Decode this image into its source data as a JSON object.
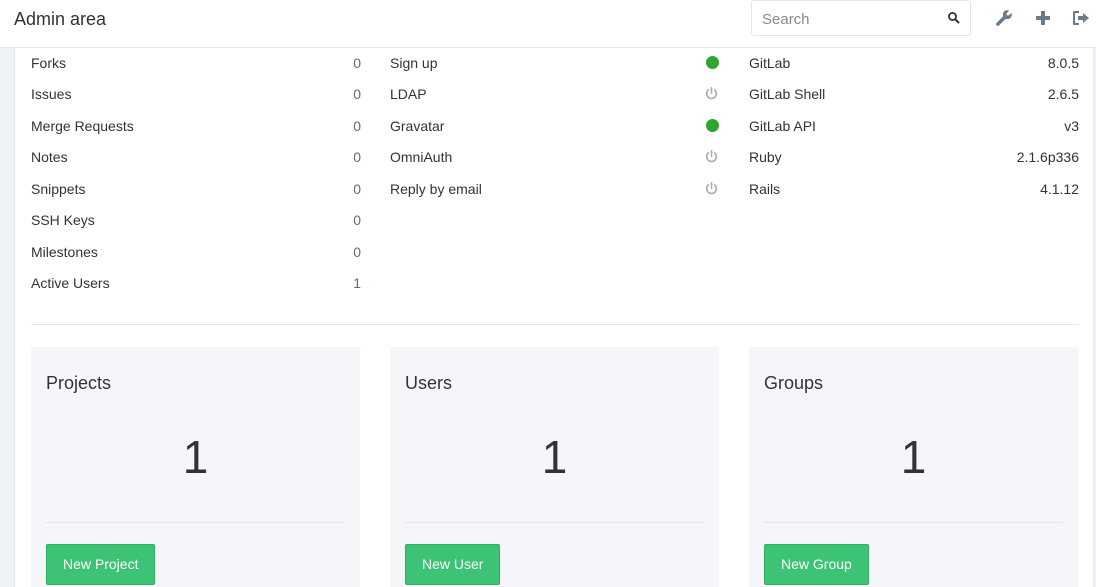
{
  "header": {
    "title": "Admin area",
    "search_placeholder": "Search",
    "icons": [
      "wrench-icon",
      "plus-icon",
      "sign-out-icon"
    ]
  },
  "stats": [
    {
      "label": "Forks",
      "value": "0"
    },
    {
      "label": "Issues",
      "value": "0"
    },
    {
      "label": "Merge Requests",
      "value": "0"
    },
    {
      "label": "Notes",
      "value": "0"
    },
    {
      "label": "Snippets",
      "value": "0"
    },
    {
      "label": "SSH Keys",
      "value": "0"
    },
    {
      "label": "Milestones",
      "value": "0"
    },
    {
      "label": "Active Users",
      "value": "1"
    }
  ],
  "features": [
    {
      "label": "Sign up",
      "enabled": true
    },
    {
      "label": "LDAP",
      "enabled": false
    },
    {
      "label": "Gravatar",
      "enabled": true
    },
    {
      "label": "OmniAuth",
      "enabled": false
    },
    {
      "label": "Reply by email",
      "enabled": false
    }
  ],
  "components": [
    {
      "label": "GitLab",
      "value": "8.0.5"
    },
    {
      "label": "GitLab Shell",
      "value": "2.6.5"
    },
    {
      "label": "GitLab API",
      "value": "v3"
    },
    {
      "label": "Ruby",
      "value": "2.1.6p336"
    },
    {
      "label": "Rails",
      "value": "4.1.12"
    }
  ],
  "panels": [
    {
      "title": "Projects",
      "count": "1",
      "button": "New Project"
    },
    {
      "title": "Users",
      "count": "1",
      "button": "New User"
    },
    {
      "title": "Groups",
      "count": "1",
      "button": "New Group"
    }
  ],
  "colors": {
    "enabled_dot": "#31a331",
    "disabled_icon": "#b0b0b0",
    "button": "#3dc375",
    "header_icon": "#6b7b8c"
  }
}
